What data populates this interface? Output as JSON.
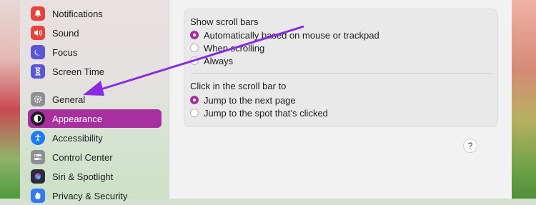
{
  "sidebar": {
    "items": [
      {
        "label": "Notifications",
        "icon": "bell-icon",
        "color": "#e8433b"
      },
      {
        "label": "Sound",
        "icon": "speaker-icon",
        "color": "#e8433b"
      },
      {
        "label": "Focus",
        "icon": "moon-icon",
        "color": "#5a56d6"
      },
      {
        "label": "Screen Time",
        "icon": "hourglass-icon",
        "color": "#5a56d6"
      },
      {
        "label": "General",
        "icon": "gear-icon",
        "color": "#8e8e93"
      },
      {
        "label": "Appearance",
        "icon": "appearance-icon",
        "color": "#1d1d1f",
        "selected": true
      },
      {
        "label": "Accessibility",
        "icon": "accessibility-icon",
        "color": "#1a7cf5"
      },
      {
        "label": "Control Center",
        "icon": "toggles-icon",
        "color": "#8e8e93"
      },
      {
        "label": "Siri & Spotlight",
        "icon": "siri-icon",
        "color": "#2b2b35"
      },
      {
        "label": "Privacy & Security",
        "icon": "hand-icon",
        "color": "#3478f6"
      }
    ]
  },
  "scroll_bars": {
    "title": "Show scroll bars",
    "options": [
      {
        "label": "Automatically based on mouse or trackpad",
        "selected": true
      },
      {
        "label": "When scrolling",
        "selected": false
      },
      {
        "label": "Always",
        "selected": false
      }
    ]
  },
  "click_scroll_bar": {
    "title": "Click in the scroll bar to",
    "options": [
      {
        "label": "Jump to the next page",
        "selected": true
      },
      {
        "label": "Jump to the spot that’s clicked",
        "selected": false
      }
    ]
  },
  "help": {
    "label": "?"
  },
  "accent_color": "#a72f9e",
  "annotation_arrow_color": "#8a2be2"
}
